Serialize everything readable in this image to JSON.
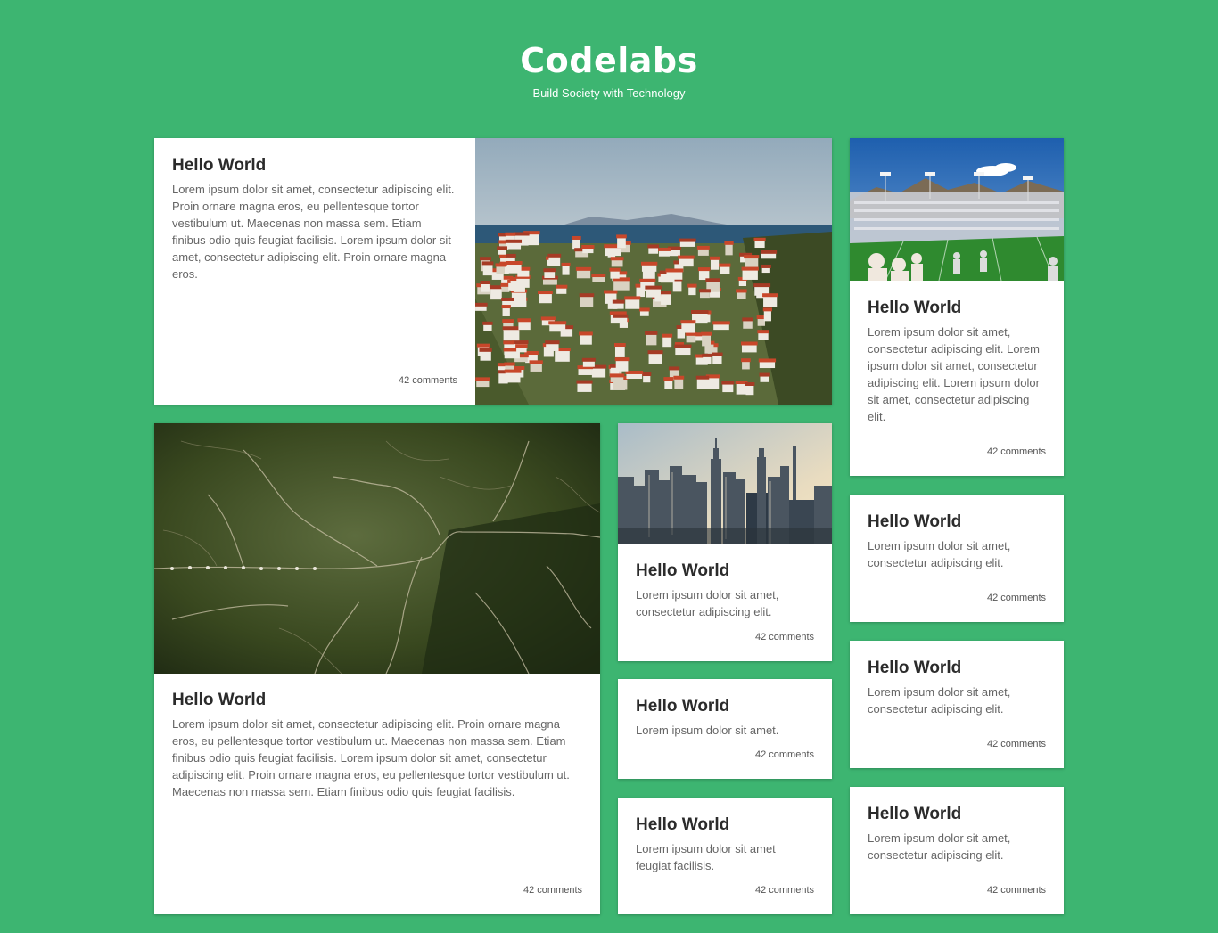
{
  "site": {
    "title": "Codelabs",
    "tagline": "Build Society with Technology"
  },
  "colors": {
    "background": "#3db571",
    "card": "#ffffff",
    "title_text": "#2b2b2b",
    "body_text": "#666666"
  },
  "cards": [
    {
      "title": "Hello World",
      "text": "Lorem ipsum dolor sit amet, consectetur adipiscing elit. Proin ornare magna eros, eu pellentesque tortor vestibulum ut. Maecenas non massa sem. Etiam finibus odio quis feugiat facilisis. Lorem ipsum dolor sit amet, consectetur adipiscing elit. Proin ornare magna eros.",
      "comments": "42 comments",
      "image": "coastal-town-photo"
    },
    {
      "title": "Hello World",
      "text": "Lorem ipsum dolor sit amet, consectetur adipiscing elit. Lorem ipsum dolor sit amet, consectetur adipiscing elit. Lorem ipsum dolor sit amet, consectetur adipiscing elit.",
      "comments": "42 comments",
      "image": "stadium-photo"
    },
    {
      "title": "Hello World",
      "text": "Lorem ipsum dolor sit amet, consectetur adipiscing elit. Proin ornare magna eros, eu pellentesque tortor vestibulum ut. Maecenas non massa sem. Etiam finibus odio quis feugiat facilisis. Lorem ipsum dolor sit amet, consectetur adipiscing elit. Proin ornare magna eros, eu pellentesque tortor vestibulum ut. Maecenas non massa sem. Etiam finibus odio quis feugiat facilisis.",
      "comments": "42 comments",
      "image": "aerial-landscape-photo"
    },
    {
      "title": "Hello World",
      "text": "Lorem ipsum dolor sit amet, consectetur adipiscing elit.",
      "comments": "42 comments",
      "image": "city-skyline-photo"
    },
    {
      "title": "Hello World",
      "text": "Lorem ipsum dolor sit amet, consectetur adipiscing elit.",
      "comments": "42 comments"
    },
    {
      "title": "Hello World",
      "text": "Lorem ipsum dolor sit amet.",
      "comments": "42 comments"
    },
    {
      "title": "Hello World",
      "text": "Lorem ipsum dolor sit amet, consectetur adipiscing elit.",
      "comments": "42 comments"
    },
    {
      "title": "Hello World",
      "text": "Lorem ipsum dolor sit amet feugiat facilisis.",
      "comments": "42 comments"
    },
    {
      "title": "Hello World",
      "text": "Lorem ipsum dolor sit amet, consectetur adipiscing elit.",
      "comments": "42 comments"
    }
  ]
}
